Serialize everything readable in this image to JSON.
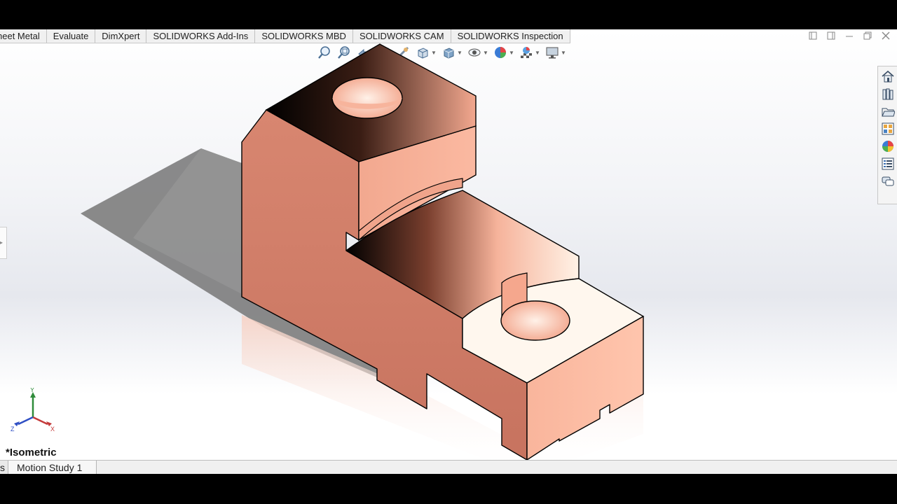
{
  "command_tabs": [
    "heet Metal",
    "Evaluate",
    "DimXpert",
    "SOLIDWORKS Add-Ins",
    "SOLIDWORKS MBD",
    "SOLIDWORKS CAM",
    "SOLIDWORKS Inspection"
  ],
  "window_controls": [
    "restore-left-icon",
    "restore-right-icon",
    "minimize-icon",
    "maximize-icon",
    "close-icon"
  ],
  "heads_up_toolbar": [
    "zoom-to-fit-icon",
    "zoom-to-area-icon",
    "previous-view-icon",
    "section-view-icon",
    "view-orientation-icon",
    "display-style-icon",
    "hide-show-items-icon",
    "edit-appearance-icon",
    "apply-scene-icon",
    "view-settings-icon"
  ],
  "task_pane": [
    "home-icon",
    "design-library-icon",
    "file-explorer-icon",
    "view-palette-icon",
    "appearances-icon",
    "custom-properties-icon",
    "forum-icon"
  ],
  "view_name": "*Isometric",
  "triad": {
    "x": "X",
    "y": "Y",
    "z": "Z"
  },
  "bottom_tabs": [
    "s",
    "Motion Study 1"
  ],
  "colors": {
    "model_face_light": "#f8b29a",
    "model_face_shaded": "#d27e6b",
    "model_top_light": "#fff6ea",
    "background": "#eef0f4"
  }
}
